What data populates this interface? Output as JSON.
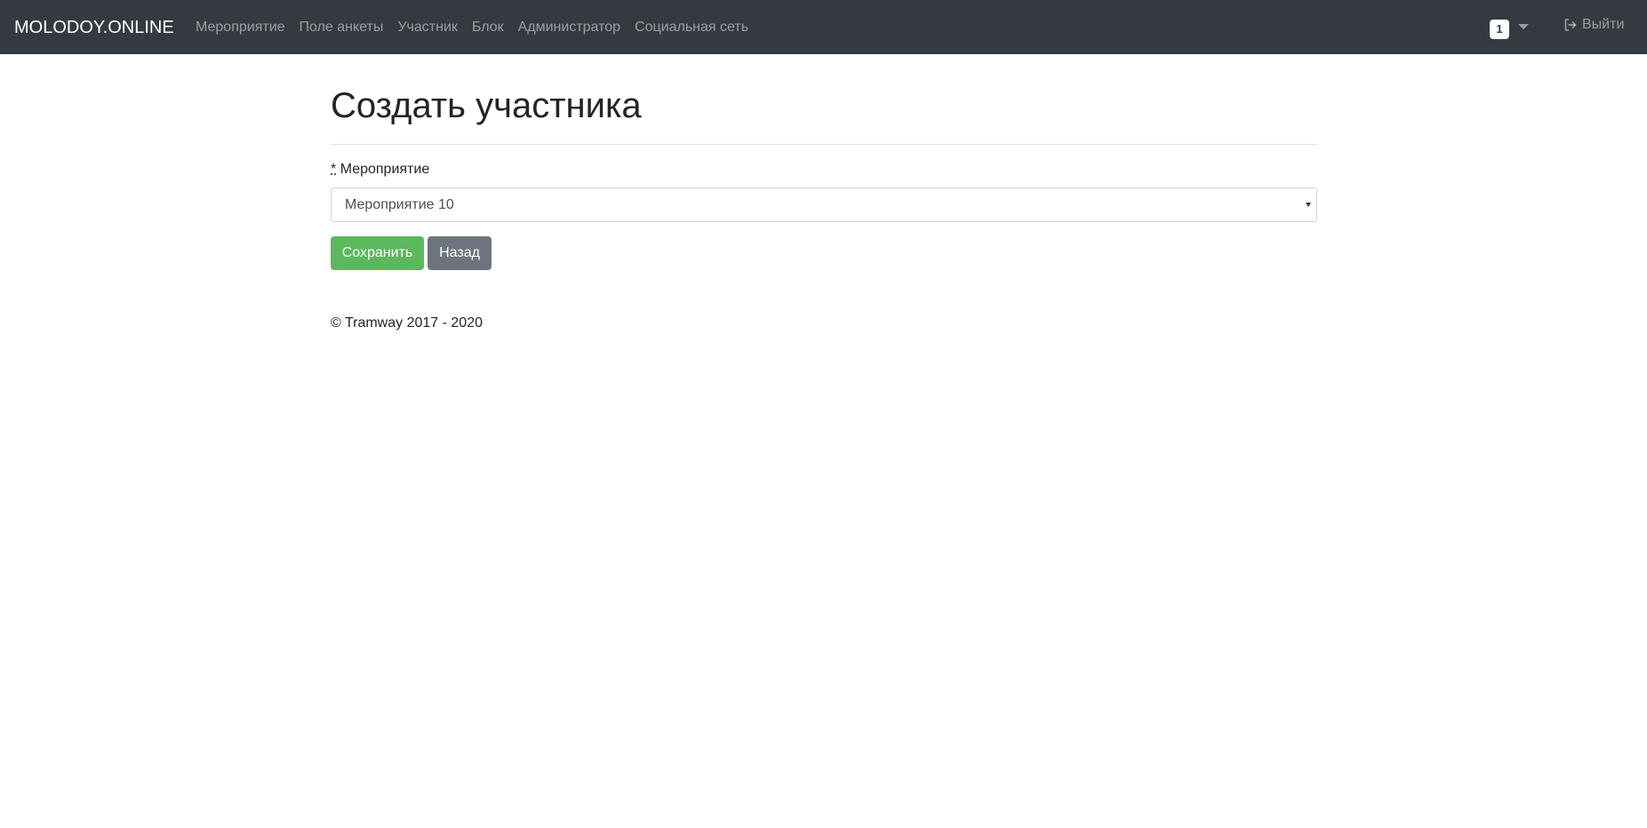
{
  "navbar": {
    "brand": "MOLODOY.ONLINE",
    "links": [
      {
        "label": "Мероприятие"
      },
      {
        "label": "Поле анкеты"
      },
      {
        "label": "Участник"
      },
      {
        "label": "Блок"
      },
      {
        "label": "Администратор"
      },
      {
        "label": "Социальная сеть"
      }
    ],
    "badge": "1",
    "logout_icon": "sign-out-icon",
    "logout_label": "Выйти"
  },
  "page": {
    "title": "Создать участника"
  },
  "form": {
    "required_marker": "*",
    "event_label": "Мероприятие",
    "event_selected": "Мероприятие 10",
    "save_label": "Сохранить",
    "back_label": "Назад"
  },
  "footer": {
    "text": "© Tramway 2017 - 2020"
  },
  "colors": {
    "navbar_bg": "#343a40",
    "save_button": "#5cb85c",
    "back_button": "#6c757d"
  }
}
